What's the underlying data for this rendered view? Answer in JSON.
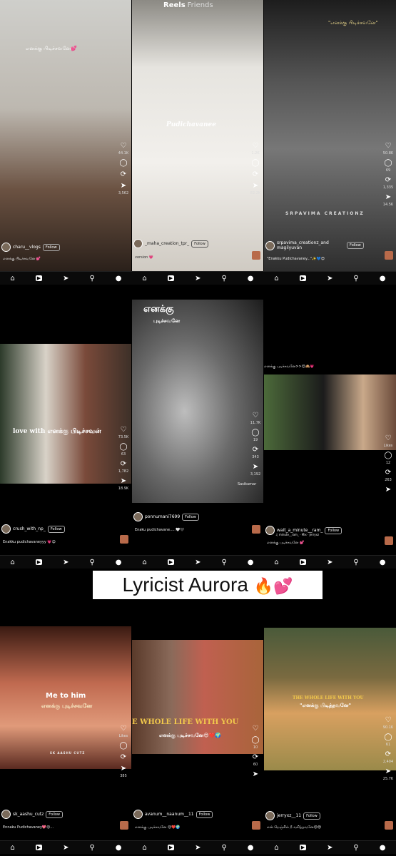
{
  "top_tabs": {
    "reels": "Reels",
    "friends": "Friends"
  },
  "banner": {
    "text": "Lyricist Aurora",
    "emoji": "🔥💕"
  },
  "panels": [
    {
      "caption_top": "எனக்கு பிடிச்சவனே💕",
      "user": "charu__vlogs",
      "follow": "Follow",
      "desc": "எனக்கு பிடிச்சவனே 💕",
      "likes": "44.1K",
      "comments": "",
      "shares": "",
      "sends": "3,562"
    },
    {
      "caption_top": "",
      "overlay": "Pudichavanee",
      "user": "_maha_creation_tpr_",
      "follow": "Follow",
      "desc": "version 💗",
      "likes": "1.2K",
      "comments": "",
      "shares": "",
      "sends": "82.2K"
    },
    {
      "caption_top": "\"எனக்கு பிடிச்சவனே\"",
      "overlay": "SRPAVIMA CREATIONZ",
      "user": "srpavima_creationz_and magilyuvan",
      "follow": "Follow",
      "desc": "\"Enakku Pudichavaney...\"✨💙😍",
      "likes": "50.8K",
      "comments": "69",
      "shares": "1,335",
      "sends": "14.5K"
    },
    {
      "caption_top": "",
      "overlay": "love with எனக்கு பிடிச்சவன்",
      "user": "crush_with_np_",
      "follow": "Follow",
      "desc": "Enakku pudichavaneyyy 💗😊",
      "likes": "73.5K",
      "comments": "63",
      "shares": "1,782",
      "sends": "18.9K"
    },
    {
      "caption_top": "எனக்கு",
      "caption_top2": "புடிச்சவனே",
      "overlay": "Sasikumar",
      "user": "ponnumani7699",
      "follow": "Follow",
      "desc": "Enaku pudichavane.....🤍🖤",
      "likes": "11.7K",
      "comments": "19",
      "shares": "343",
      "sends": "3,192"
    },
    {
      "caption_top": "எனக்கு புடிச்சவனே>>😊🙈💗",
      "user": "wait_a_minute__ram_",
      "audio": "♫ minute__ram_ · Mix · jerryxz",
      "follow": "Follow",
      "desc": "எனக்கு புடிச்சவனே 💕",
      "likes": "Likes",
      "comments": "12",
      "shares": "263",
      "sends": ""
    },
    {
      "caption_top": "",
      "overlay": "Me to him",
      "overlay2": "எனக்கு புடிச்சவனே",
      "overlay3": "SK AASHU CUTZ",
      "user": "sk_aashu_cutz",
      "follow": "Follow",
      "desc": "Ennaku Pudichavaney💖😊...",
      "likes": "Likes",
      "comments": "",
      "shares": "",
      "sends": "385"
    },
    {
      "caption_top": "",
      "overlay": "E WHOLE LIFE WITH YOU",
      "overlay2": "எனக்கு புடிச்சவனே😍❤️🌍",
      "user": "avanum__naanum__11",
      "follow": "Follow",
      "desc": "எனக்கு புடிச்சவனே 😊❤️🌍",
      "likes": "",
      "comments": "10",
      "shares": "60",
      "sends": ""
    },
    {
      "caption_top": "",
      "overlay": "THE WHOLE LIFE WITH YOU",
      "overlay2": "\"எனக்கு பிடித்தவனே\"",
      "user": "jerryxz__11",
      "follow": "Follow",
      "desc": "என் நெஞ்சில் நீ வசித்தவனே😊😍",
      "likes": "90.1K",
      "comments": "61",
      "shares": "2,404",
      "sends": "25.7K"
    }
  ],
  "icons": {
    "heart": "heart-icon",
    "comment": "comment-icon",
    "share": "repost-icon",
    "send": "send-icon",
    "more": "more-icon"
  }
}
